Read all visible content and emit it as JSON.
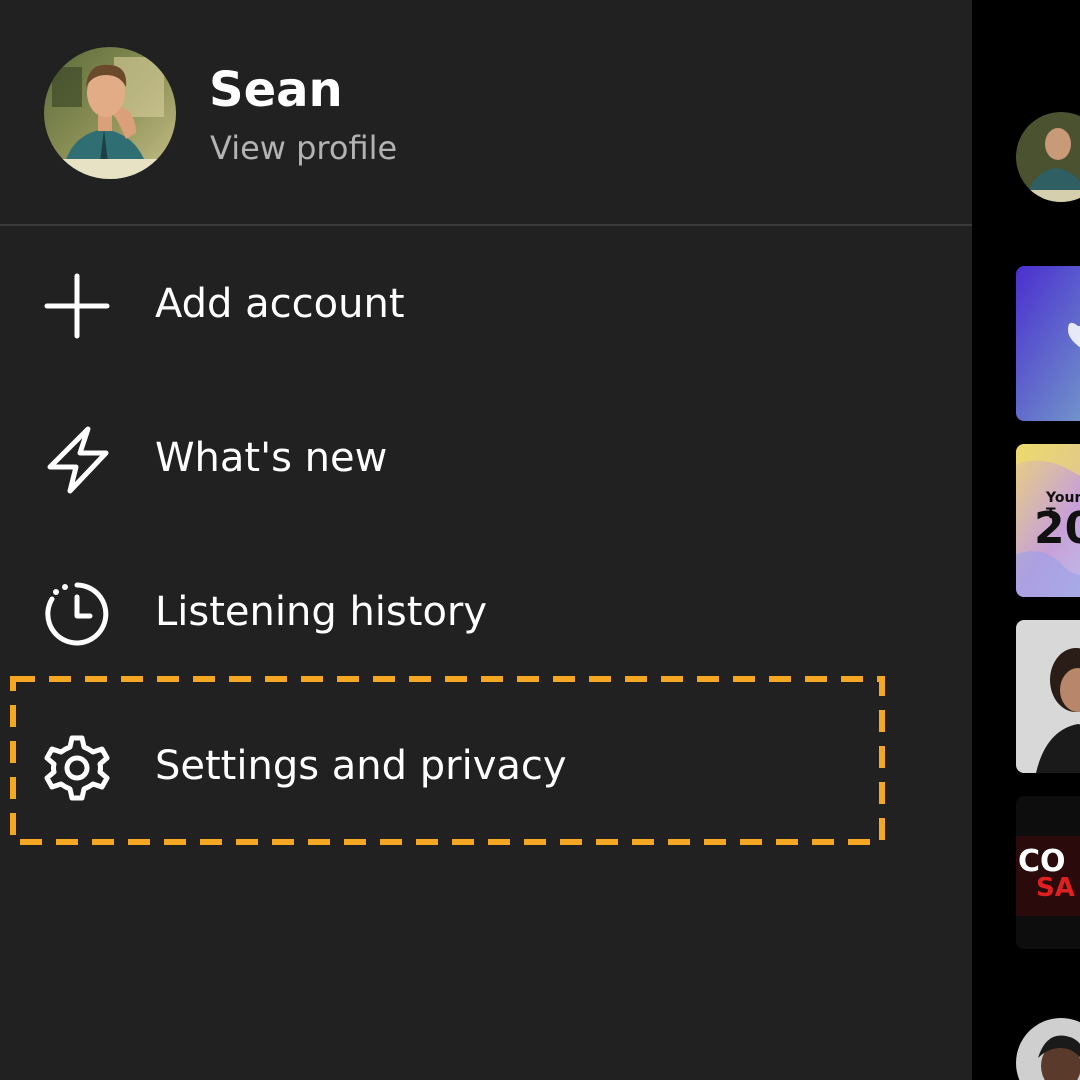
{
  "profile": {
    "name": "Sean",
    "subtitle": "View profile"
  },
  "menu": [
    {
      "label": "Add account",
      "icon": "plus-icon"
    },
    {
      "label": "What's new",
      "icon": "lightning-bolt-icon"
    },
    {
      "label": "Listening history",
      "icon": "history-clock-icon"
    },
    {
      "label": "Settings and privacy",
      "icon": "gear-icon"
    }
  ],
  "background": {
    "wrapped_card_text_1": "Your T",
    "wrapped_card_text_2": "20",
    "podcast_card_text_1": "CO",
    "podcast_card_text_2": "SA"
  },
  "colors": {
    "drawer": "#212121",
    "highlight": "#F5A623",
    "text": "#FFFFFF",
    "subtext": "#B3B3B3"
  }
}
